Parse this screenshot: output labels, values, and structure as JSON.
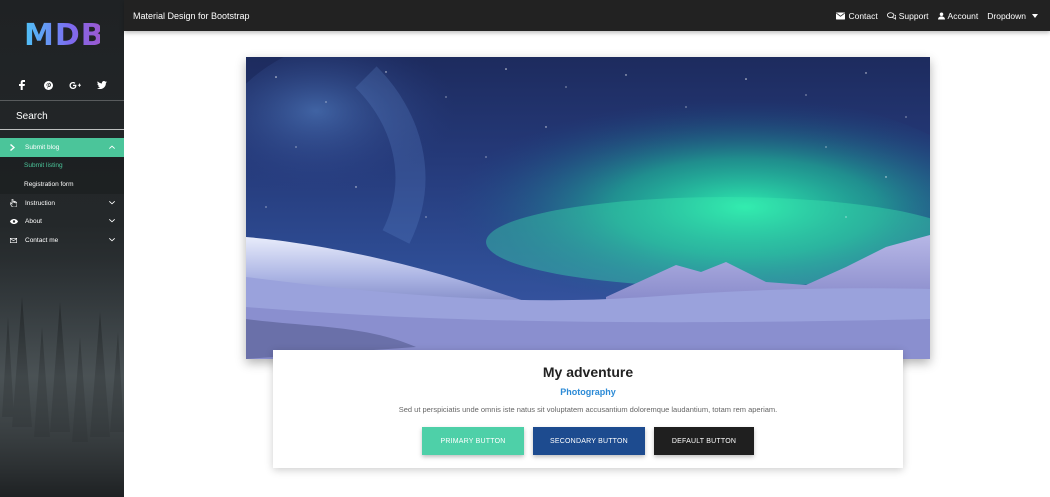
{
  "colors": {
    "accent": "#4bc59a",
    "primary_button": "#4ed0a8",
    "secondary_button": "#1d4b8f",
    "default_button": "#1f1f1f",
    "navbar": "#222222",
    "link": "#2b8ad6"
  },
  "sidebar": {
    "logo": "MDB",
    "social": [
      "facebook-icon",
      "pinterest-icon",
      "google-plus-icon",
      "twitter-icon"
    ],
    "search_placeholder": "Search",
    "menu": [
      {
        "label": "Submit blog",
        "icon": "chevron-right-icon",
        "active": true,
        "expanded": true
      },
      {
        "label": "Submit listing",
        "sub": true
      },
      {
        "label": "Registration form",
        "sub": true
      },
      {
        "label": "Instruction",
        "icon": "hand-pointer-icon"
      },
      {
        "label": "About",
        "icon": "eye-icon"
      },
      {
        "label": "Contact me",
        "icon": "envelope-icon"
      }
    ]
  },
  "navbar": {
    "brand": "Material Design for Bootstrap",
    "links": [
      {
        "label": "Contact",
        "icon": "envelope-icon"
      },
      {
        "label": "Support",
        "icon": "comments-icon"
      },
      {
        "label": "Account",
        "icon": "user-icon"
      },
      {
        "label": "Dropdown",
        "icon": "caret-down-icon"
      }
    ]
  },
  "card": {
    "title": "My adventure",
    "subtitle": "Photography",
    "text": "Sed ut perspiciatis unde omnis iste natus sit voluptatem accusantium doloremque laudantium, totam rem aperiam.",
    "buttons": {
      "primary": "PRIMARY BUTTON",
      "secondary": "SECONDARY BUTTON",
      "default": "DEFAULT BUTTON"
    }
  }
}
